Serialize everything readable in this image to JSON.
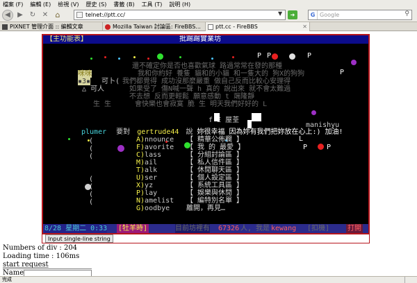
{
  "browser": {
    "menu": [
      "檔案 (F)",
      "編輯 (E)",
      "檢視 (V)",
      "歷史 (S)",
      "書籤 (B)",
      "工具 (T)",
      "說明 (H)"
    ],
    "url": "telnet://ptt.cc/",
    "search_placeholder": "Google",
    "tabs": [
      {
        "label": "PIXNET 管理介面 :: 編輯文章",
        "active": false
      },
      {
        "label": "Mozilla Taiwan 討論區: FireBBS...",
        "active": false
      },
      {
        "label": "ptt.cc - FireBBS",
        "active": true
      }
    ],
    "status": "完成"
  },
  "terminal": {
    "header_left": "【主功能表】",
    "header_center": "批踢踢實業坊",
    "art_lines": [
      "還不確定你是否也喜歡氣球 路過常常在發的那種",
      "我和你約好 養隻  貓和的小貓 和一隻大的  狗X的狗狗",
      "我們都覺得 成功沒那麼嚴重 做自己反而比較心安理得",
      "如果受了 傷N喊一聲 h 真的 說出來 就不會太難過",
      "不去想        反而更輕鬆 願意感動   t 端隆靜",
      "會快樂也會寂寞     脆 生       明天我們好好的  L",
      "f  E  屋荃"
    ],
    "art_side": [
      "可卜(",
      "△ 可人",
      "生   生"
    ],
    "art_badge": [
      "咪咪",
      "▪3▪"
    ],
    "art_letters": [
      "P",
      "P",
      "P",
      "P",
      "P",
      "P",
      "L"
    ],
    "signature": "manishyu",
    "whisper": {
      "from": "plumer",
      "verb": "要對",
      "to": "gertrude44",
      "say": "說",
      "message": "妳很幸福 因為妳有我們把妳放在心上:) 加油!"
    },
    "menu": [
      {
        "key": "A)",
        "label": "nnounce",
        "desc": "【 精華公佈欄 】"
      },
      {
        "key": "F)",
        "label": "avorite",
        "desc": "【 我 的 最愛 】"
      },
      {
        "key": "C)",
        "label": "lass",
        "desc": "【 分組討論區 】"
      },
      {
        "key": "M)",
        "label": "ail",
        "desc": "【 私人信件區 】"
      },
      {
        "key": "T)",
        "label": "alk",
        "desc": "【 休閒聊天區 】"
      },
      {
        "key": "U)",
        "label": "ser",
        "desc": "【 個人設定區 】"
      },
      {
        "key": "X)",
        "label": "yz",
        "desc": "【 系統工具區 】"
      },
      {
        "key": "P)",
        "label": "lay",
        "desc": "【 娛樂與休閒 】"
      },
      {
        "key": "N)",
        "label": "amelist",
        "desc": "【 編特別名單 】"
      },
      {
        "key": "G)",
        "label": "oodbye",
        "desc": "離開，再見…"
      }
    ],
    "status": {
      "datetime": "8/28 星期二 0:33",
      "zodiac": "[牡羊時]",
      "online_label": "目前坊裡有",
      "online_count": "67326",
      "online_suffix": "人, 我是",
      "user": "kewang",
      "mode": "[扣機]",
      "state": "打開"
    }
  },
  "input_button": "Input single-line string",
  "debug": {
    "divs": "Numbers of div : 204",
    "loading": "Loading time : 106ms",
    "request": "start request",
    "name_label": "Name :"
  }
}
